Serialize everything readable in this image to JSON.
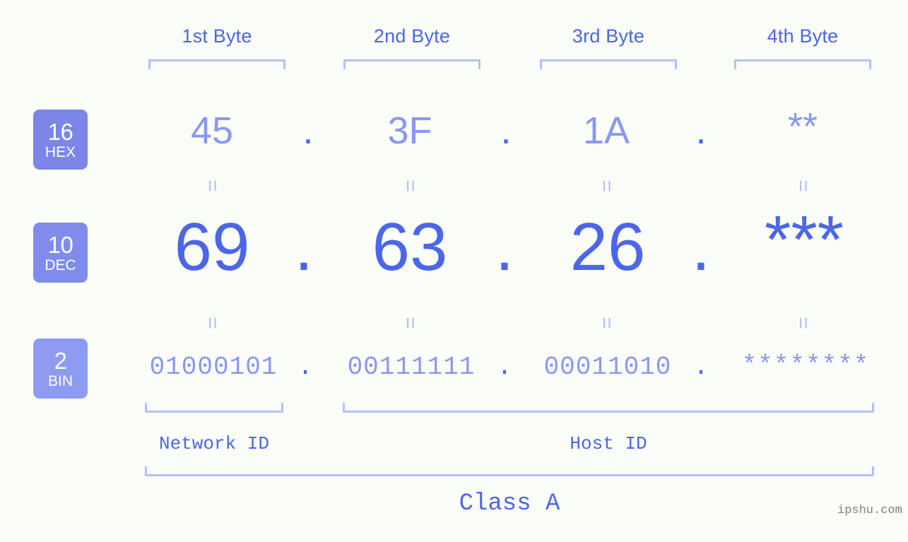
{
  "page": {
    "background": "#fbfdf8",
    "accent_strong": "#4b66e8",
    "accent_light": "#8a97f2",
    "accent_pale": "#b5c0f7",
    "badge_hex_color": "#7b86e8",
    "badge_dec_color": "#7f8cec",
    "badge_bin_color": "#8d9bf3"
  },
  "byte_headers": [
    {
      "label": "1st Byte"
    },
    {
      "label": "2nd Byte"
    },
    {
      "label": "3rd Byte"
    },
    {
      "label": "4th Byte"
    }
  ],
  "bases": [
    {
      "number": "16",
      "name": "HEX"
    },
    {
      "number": "10",
      "name": "DEC"
    },
    {
      "number": "2",
      "name": "BIN"
    }
  ],
  "separator": ".",
  "equals_sign": "=",
  "rows": {
    "hex": {
      "base_number": "16",
      "base_name": "HEX",
      "values": [
        "45",
        "3F",
        "1A",
        "**"
      ]
    },
    "dec": {
      "base_number": "10",
      "base_name": "DEC",
      "values": [
        "69",
        "63",
        "26",
        "***"
      ]
    },
    "bin": {
      "base_number": "2",
      "base_name": "BIN",
      "values": [
        "01000101",
        "00111111",
        "00011010",
        "********"
      ]
    }
  },
  "regions": {
    "network_id": "Network ID",
    "host_id": "Host ID",
    "class": "Class A"
  },
  "watermark": "ipshu.com"
}
